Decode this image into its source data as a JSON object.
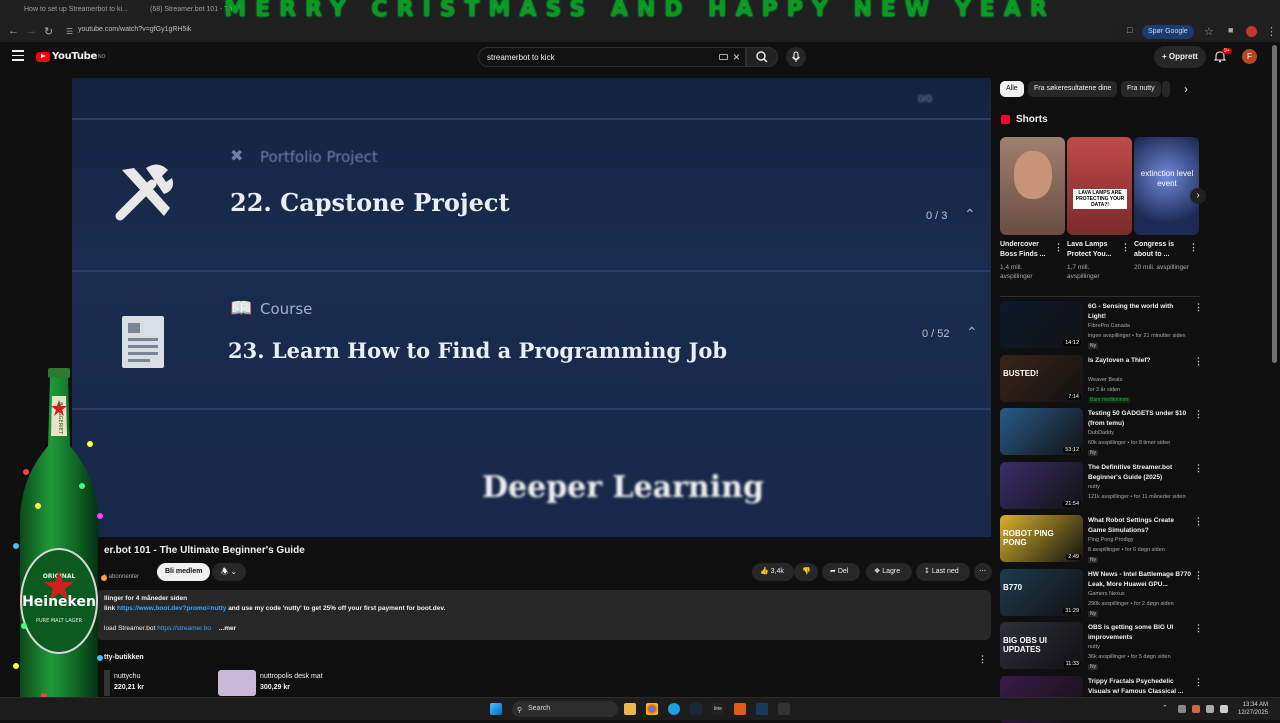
{
  "browser": {
    "tab1": "How to set up Streamerbot to ki...",
    "tab2": "(68) Streamer.bot 101 - Th...",
    "overlay_banner": "MERRY CRISTMASS AND HAPPY NEW YEAR",
    "url": "youtube.com/watch?v=gfGy1gRH5ik",
    "ask_google": "Spør Google"
  },
  "header": {
    "logo": "YouTube",
    "logo_suffix": "NO",
    "search_value": "streamerbot to kick",
    "create_label": "Opprett",
    "notif_badge": "9+",
    "avatar_letter": "F"
  },
  "player": {
    "card1_sub": "Portfolio Project",
    "card1_title": "22. Capstone Project",
    "card1_count": "0 / 3",
    "card2_sub": "Course",
    "card2_title": "23. Learn How to Find a Programming Job",
    "card2_count": "0 / 52",
    "card3_title": "Deeper Learning"
  },
  "video": {
    "title": "er.bot 101 - The Ultimate Beginner's Guide",
    "subs": "k abonnenter",
    "join_label": "Bli medlem",
    "likes": "3,4k",
    "share": "Del",
    "save": "Lagre",
    "download": "Last ned",
    "desc_line1": "llinger  for 4 måneder siden",
    "desc_line2_prefix": "link",
    "desc_link1": "https://www.boot.dev?promo=nutty",
    "desc_line2_suffix": "and use my code 'nutty' to get 25% off your first payment for boot.dev.",
    "desc_line3_prefix": "load Streamer.bot",
    "desc_link2": "https://streamer.bo",
    "more": "...mer",
    "shop_title": "tty-butikken",
    "shop1_name": "nuttychu",
    "shop1_price": "220,21 kr",
    "shop2_name": "nuttropolis desk mat",
    "shop2_price": "300,29 kr"
  },
  "sidebar": {
    "chips": [
      "Alle",
      "Fra søkeresultatene dine",
      "Fra nutty"
    ],
    "shorts_label": "Shorts",
    "shorts": [
      {
        "title": "Undercover Boss Finds ...",
        "views": "1,4 mill. avspillinger",
        "color": "#7a5c4a"
      },
      {
        "title": "Lava Lamps Protect You...",
        "views": "1,7 mill. avspillinger",
        "color": "#a33a3a",
        "caption": "LAVA LAMPS ARE PROTECTING YOUR DATA?!"
      },
      {
        "title": "Congress is about to ...",
        "views": "20 mill. avspillinger",
        "color": "#1d2a55",
        "caption": "extinction level event"
      }
    ],
    "recs": [
      {
        "title": "6G - Sensing the world with Light!",
        "channel": "FibrePro Canada",
        "meta": "ingen avspillinger • for 21 minutter siden",
        "badge": "Ny",
        "duration": "14:12",
        "color": "#0b1a2e"
      },
      {
        "title": "Is Zaytoven a Thief?",
        "channel": "Weaver Beats",
        "meta": "for 3 år siden",
        "badge": "Bare medlemmer",
        "duration": "7:14",
        "color": "#3a2418",
        "caption": "BUSTED!"
      },
      {
        "title": "Testing 50 GADGETS under $10 (from temu)",
        "channel": "DubDaddy",
        "meta": "60k avspillinger • for 8 timer siden",
        "badge": "Ny",
        "duration": "53:12",
        "color": "#2a5a8a"
      },
      {
        "title": "The Definitive Streamer.bot Beginner's Guide (2025)",
        "channel": "nutty",
        "meta": "121k avspillinger • for 11 måneder siden",
        "badge": "",
        "duration": "21:54",
        "color": "#3a2e6a"
      },
      {
        "title": "What Robot Settings Create Game Simulations?",
        "channel": "Ping Pong Prodigy",
        "meta": "8 avspillinger • for 6 døgn siden",
        "badge": "Ny",
        "duration": "2:49",
        "color": "#d8b12a",
        "caption": "ROBOT PING PONG"
      },
      {
        "title": "HW News - Intel Battlemage B770 Leak, More Huawei GPU...",
        "channel": "Gamers Nexus",
        "meta": "290k avspillinger • for 2 døgn siden",
        "badge": "Ny",
        "duration": "31:29",
        "color": "#1d3b4e",
        "caption": "B770"
      },
      {
        "title": "OBS is getting some BIG UI improvements",
        "channel": "nutty",
        "meta": "36k avspillinger • for 5 døgn siden",
        "badge": "Ny",
        "duration": "11:33",
        "color": "#2e2e3e",
        "caption": "BIG OBS UI UPDATES"
      },
      {
        "title": "Trippy Fractals Psychedelic Visuals w/ Famous Classical ...",
        "channel": "",
        "meta": "",
        "badge": "",
        "duration": "",
        "color": "#3a1a4a"
      }
    ]
  },
  "taskbar": {
    "search": "Search",
    "time": "13:34 AM",
    "date": "12/27/2025"
  },
  "beer": {
    "brand": "Heineken",
    "label_top": "BRYGGERIET",
    "label_ring": "ORIGINAL PURE MALT LAGER"
  }
}
